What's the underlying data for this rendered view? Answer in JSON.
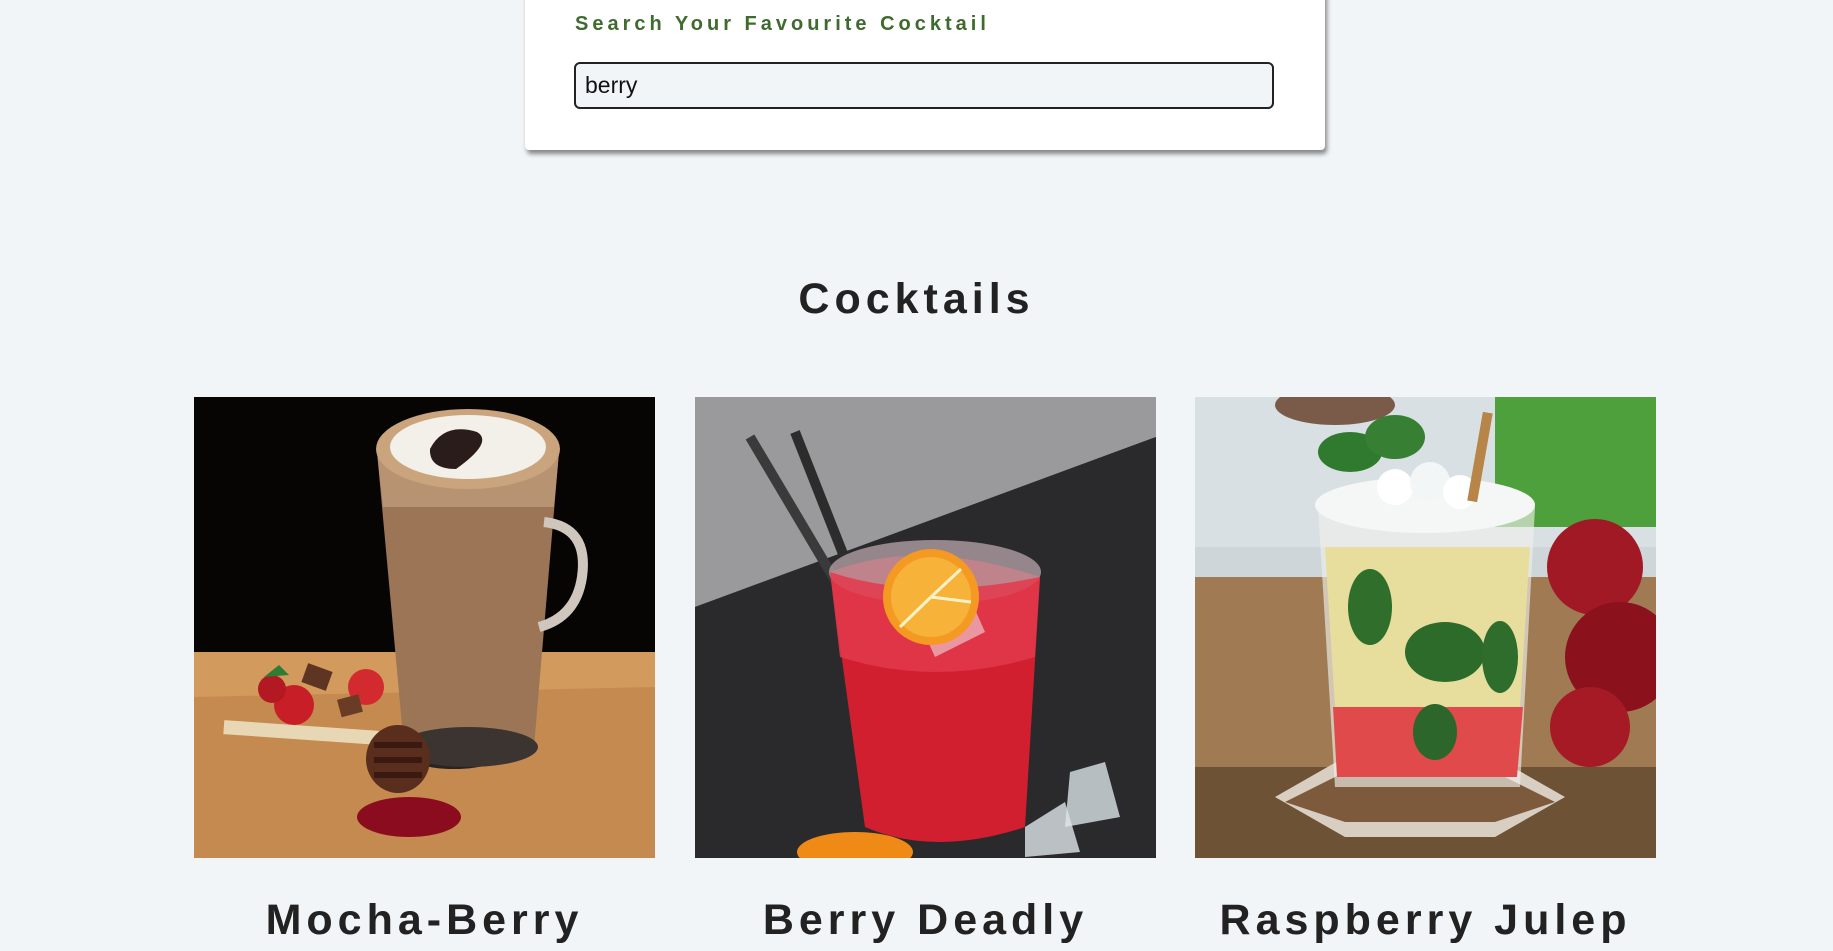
{
  "search": {
    "label": "Search Your Favourite Cocktail",
    "value": "berry"
  },
  "section": {
    "title": "Cocktails"
  },
  "cocktails": [
    {
      "name": "Mocha-Berry"
    },
    {
      "name": "Berry Deadly"
    },
    {
      "name": "Raspberry Julep"
    }
  ]
}
